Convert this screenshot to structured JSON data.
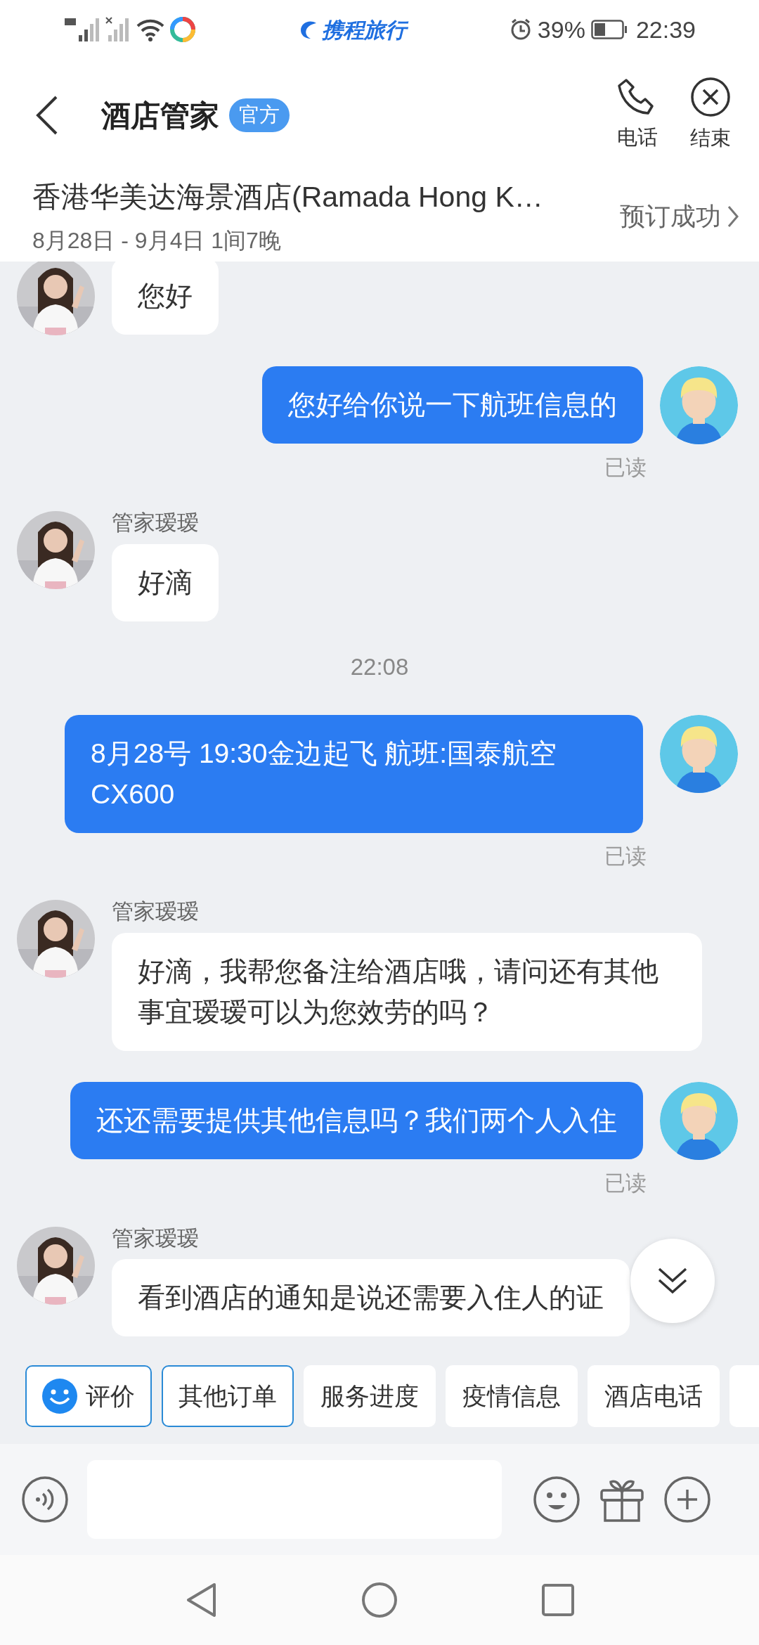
{
  "status_bar": {
    "app_name": "携程旅行",
    "battery": "39%",
    "time": "22:39"
  },
  "header": {
    "title": "酒店管家",
    "badge": "官方",
    "actions": [
      {
        "kind": "phone",
        "label": "电话"
      },
      {
        "kind": "end",
        "label": "结束"
      }
    ]
  },
  "order": {
    "hotel": "香港华美达海景酒店(Ramada Hong K…",
    "dates": "8月28日 - 9月4日 1间7晚",
    "status": "预订成功"
  },
  "messages": [
    {
      "kind": "agent",
      "text": "您好"
    },
    {
      "kind": "user",
      "text": "您好给你说一下航班信息的",
      "receipt": "已读"
    },
    {
      "kind": "agent",
      "sender": "管家瑷瑷",
      "text": "好滴"
    },
    {
      "kind": "time",
      "text": "22:08"
    },
    {
      "kind": "user",
      "text": "8月28号  19:30金边起飞 航班:国泰航空CX600",
      "receipt": "已读"
    },
    {
      "kind": "agent",
      "sender": "管家瑷瑷",
      "text": "好滴，我帮您备注给酒店哦，请问还有其他事宜瑷瑷可以为您效劳的吗？"
    },
    {
      "kind": "user",
      "text": "还还需要提供其他信息吗？我们两个人入住",
      "receipt": "已读"
    },
    {
      "kind": "agent",
      "sender": "管家瑷瑷",
      "text": "看到酒店的通知是说还需要入住人的证"
    }
  ],
  "quick_replies": [
    {
      "kind": "rate",
      "label": "评价",
      "highlighted": true
    },
    {
      "kind": "plain",
      "label": "其他订单",
      "highlighted": true
    },
    {
      "kind": "plain",
      "label": "服务进度",
      "highlighted": false
    },
    {
      "kind": "plain",
      "label": "疫情信息",
      "highlighted": false
    },
    {
      "kind": "plain",
      "label": "酒店电话",
      "highlighted": false
    },
    {
      "kind": "plain",
      "highlighted": false
    }
  ]
}
